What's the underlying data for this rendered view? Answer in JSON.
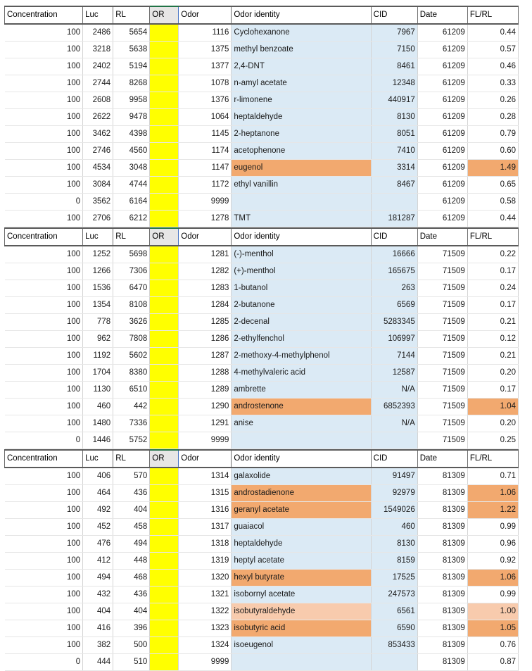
{
  "columns": [
    {
      "key": "concentration",
      "label": "Concentration"
    },
    {
      "key": "luc",
      "label": "Luc"
    },
    {
      "key": "rl",
      "label": "RL"
    },
    {
      "key": "or",
      "label": "OR"
    },
    {
      "key": "odor",
      "label": "Odor"
    },
    {
      "key": "identity",
      "label": "Odor identity"
    },
    {
      "key": "cid",
      "label": "CID"
    },
    {
      "key": "date",
      "label": "Date"
    },
    {
      "key": "flrl",
      "label": "FL/RL"
    }
  ],
  "colors": {
    "or_column_fill": "#ffff00",
    "identity_fill": "#dbeaf5",
    "cid_fill": "#dbeaf5",
    "highlight_light": "#f8cbad",
    "highlight_mid": "#f4b183",
    "highlight_strong": "#f2a96f",
    "header_selected_fill": "#e7e6e6",
    "header_border": "#5a5a5a",
    "selection_tab_green": "#217346"
  },
  "blocks": [
    {
      "id": "block-61209",
      "date": "61209",
      "rows": [
        {
          "concentration": "100",
          "luc": "2486",
          "rl": "5654",
          "or": "",
          "odor": "1116",
          "identity": "Cyclohexanone",
          "cid": "7967",
          "date": "61209",
          "flrl": "0.44",
          "highlight": 0
        },
        {
          "concentration": "100",
          "luc": "3218",
          "rl": "5638",
          "or": "",
          "odor": "1375",
          "identity": "methyl benzoate",
          "cid": "7150",
          "date": "61209",
          "flrl": "0.57",
          "highlight": 0
        },
        {
          "concentration": "100",
          "luc": "2402",
          "rl": "5194",
          "or": "",
          "odor": "1377",
          "identity": "2,4-DNT",
          "cid": "8461",
          "date": "61209",
          "flrl": "0.46",
          "highlight": 0
        },
        {
          "concentration": "100",
          "luc": "2744",
          "rl": "8268",
          "or": "",
          "odor": "1078",
          "identity": "n-amyl acetate",
          "cid": "12348",
          "date": "61209",
          "flrl": "0.33",
          "highlight": 0
        },
        {
          "concentration": "100",
          "luc": "2608",
          "rl": "9958",
          "or": "",
          "odor": "1376",
          "identity": "r-limonene",
          "cid": "440917",
          "date": "61209",
          "flrl": "0.26",
          "highlight": 0
        },
        {
          "concentration": "100",
          "luc": "2622",
          "rl": "9478",
          "or": "",
          "odor": "1064",
          "identity": "heptaldehyde",
          "cid": "8130",
          "date": "61209",
          "flrl": "0.28",
          "highlight": 0
        },
        {
          "concentration": "100",
          "luc": "3462",
          "rl": "4398",
          "or": "",
          "odor": "1145",
          "identity": "2-heptanone",
          "cid": "8051",
          "date": "61209",
          "flrl": "0.79",
          "highlight": 0
        },
        {
          "concentration": "100",
          "luc": "2746",
          "rl": "4560",
          "or": "",
          "odor": "1174",
          "identity": "acetophenone",
          "cid": "7410",
          "date": "61209",
          "flrl": "0.60",
          "highlight": 0
        },
        {
          "concentration": "100",
          "luc": "4534",
          "rl": "3048",
          "or": "",
          "odor": "1147",
          "identity": "eugenol",
          "cid": "3314",
          "date": "61209",
          "flrl": "1.49",
          "highlight": 3
        },
        {
          "concentration": "100",
          "luc": "3084",
          "rl": "4744",
          "or": "",
          "odor": "1172",
          "identity": "ethyl vanillin",
          "cid": "8467",
          "date": "61209",
          "flrl": "0.65",
          "highlight": 0
        },
        {
          "concentration": "0",
          "luc": "3562",
          "rl": "6164",
          "or": "",
          "odor": "9999",
          "identity": "",
          "cid": "",
          "date": "61209",
          "flrl": "0.58",
          "highlight": 0
        },
        {
          "concentration": "100",
          "luc": "2706",
          "rl": "6212",
          "or": "",
          "odor": "1278",
          "identity": "TMT",
          "cid": "181287",
          "date": "61209",
          "flrl": "0.44",
          "highlight": 0
        }
      ]
    },
    {
      "id": "block-71509",
      "date": "71509",
      "rows": [
        {
          "concentration": "100",
          "luc": "1252",
          "rl": "5698",
          "or": "",
          "odor": "1281",
          "identity": "(-)-menthol",
          "cid": "16666",
          "date": "71509",
          "flrl": "0.22",
          "highlight": 0
        },
        {
          "concentration": "100",
          "luc": "1266",
          "rl": "7306",
          "or": "",
          "odor": "1282",
          "identity": "(+)-menthol",
          "cid": "165675",
          "date": "71509",
          "flrl": "0.17",
          "highlight": 0
        },
        {
          "concentration": "100",
          "luc": "1536",
          "rl": "6470",
          "or": "",
          "odor": "1283",
          "identity": "1-butanol",
          "cid": "263",
          "date": "71509",
          "flrl": "0.24",
          "highlight": 0
        },
        {
          "concentration": "100",
          "luc": "1354",
          "rl": "8108",
          "or": "",
          "odor": "1284",
          "identity": "2-butanone",
          "cid": "6569",
          "date": "71509",
          "flrl": "0.17",
          "highlight": 0
        },
        {
          "concentration": "100",
          "luc": "778",
          "rl": "3626",
          "or": "",
          "odor": "1285",
          "identity": "2-decenal",
          "cid": "5283345",
          "date": "71509",
          "flrl": "0.21",
          "highlight": 0
        },
        {
          "concentration": "100",
          "luc": "962",
          "rl": "7808",
          "or": "",
          "odor": "1286",
          "identity": "2-ethylfenchol",
          "cid": "106997",
          "date": "71509",
          "flrl": "0.12",
          "highlight": 0
        },
        {
          "concentration": "100",
          "luc": "1192",
          "rl": "5602",
          "or": "",
          "odor": "1287",
          "identity": "2-methoxy-4-methylphenol",
          "cid": "7144",
          "date": "71509",
          "flrl": "0.21",
          "highlight": 0
        },
        {
          "concentration": "100",
          "luc": "1704",
          "rl": "8380",
          "or": "",
          "odor": "1288",
          "identity": "4-methylvaleric acid",
          "cid": "12587",
          "date": "71509",
          "flrl": "0.20",
          "highlight": 0
        },
        {
          "concentration": "100",
          "luc": "1130",
          "rl": "6510",
          "or": "",
          "odor": "1289",
          "identity": "ambrette",
          "cid": "N/A",
          "date": "71509",
          "flrl": "0.17",
          "highlight": 0
        },
        {
          "concentration": "100",
          "luc": "460",
          "rl": "442",
          "or": "",
          "odor": "1290",
          "identity": "androstenone",
          "cid": "6852393",
          "date": "71509",
          "flrl": "1.04",
          "highlight": 3
        },
        {
          "concentration": "100",
          "luc": "1480",
          "rl": "7336",
          "or": "",
          "odor": "1291",
          "identity": "anise",
          "cid": "N/A",
          "date": "71509",
          "flrl": "0.20",
          "highlight": 0
        },
        {
          "concentration": "0",
          "luc": "1446",
          "rl": "5752",
          "or": "",
          "odor": "9999",
          "identity": "",
          "cid": "",
          "date": "71509",
          "flrl": "0.25",
          "highlight": 0
        }
      ]
    },
    {
      "id": "block-81309",
      "date": "81309",
      "rows": [
        {
          "concentration": "100",
          "luc": "406",
          "rl": "570",
          "or": "",
          "odor": "1314",
          "identity": "galaxolide",
          "cid": "91497",
          "date": "81309",
          "flrl": "0.71",
          "highlight": 0
        },
        {
          "concentration": "100",
          "luc": "464",
          "rl": "436",
          "or": "",
          "odor": "1315",
          "identity": "androstadienone",
          "cid": "92979",
          "date": "81309",
          "flrl": "1.06",
          "highlight": 3
        },
        {
          "concentration": "100",
          "luc": "492",
          "rl": "404",
          "or": "",
          "odor": "1316",
          "identity": "geranyl acetate",
          "cid": "1549026",
          "date": "81309",
          "flrl": "1.22",
          "highlight": 3
        },
        {
          "concentration": "100",
          "luc": "452",
          "rl": "458",
          "or": "",
          "odor": "1317",
          "identity": "guaiacol",
          "cid": "460",
          "date": "81309",
          "flrl": "0.99",
          "highlight": 0
        },
        {
          "concentration": "100",
          "luc": "476",
          "rl": "494",
          "or": "",
          "odor": "1318",
          "identity": "heptaldehyde",
          "cid": "8130",
          "date": "81309",
          "flrl": "0.96",
          "highlight": 0
        },
        {
          "concentration": "100",
          "luc": "412",
          "rl": "448",
          "or": "",
          "odor": "1319",
          "identity": "heptyl acetate",
          "cid": "8159",
          "date": "81309",
          "flrl": "0.92",
          "highlight": 0
        },
        {
          "concentration": "100",
          "luc": "494",
          "rl": "468",
          "or": "",
          "odor": "1320",
          "identity": "hexyl butyrate",
          "cid": "17525",
          "date": "81309",
          "flrl": "1.06",
          "highlight": 3
        },
        {
          "concentration": "100",
          "luc": "432",
          "rl": "436",
          "or": "",
          "odor": "1321",
          "identity": "isobornyl acetate",
          "cid": "247573",
          "date": "81309",
          "flrl": "0.99",
          "highlight": 0
        },
        {
          "concentration": "100",
          "luc": "404",
          "rl": "404",
          "or": "",
          "odor": "1322",
          "identity": "isobutyraldehyde",
          "cid": "6561",
          "date": "81309",
          "flrl": "1.00",
          "highlight": 1
        },
        {
          "concentration": "100",
          "luc": "416",
          "rl": "396",
          "or": "",
          "odor": "1323",
          "identity": "isobutyric acid",
          "cid": "6590",
          "date": "81309",
          "flrl": "1.05",
          "highlight": 3
        },
        {
          "concentration": "100",
          "luc": "382",
          "rl": "500",
          "or": "",
          "odor": "1324",
          "identity": "isoeugenol",
          "cid": "853433",
          "date": "81309",
          "flrl": "0.76",
          "highlight": 0
        },
        {
          "concentration": "0",
          "luc": "444",
          "rl": "510",
          "or": "",
          "odor": "9999",
          "identity": "",
          "cid": "",
          "date": "81309",
          "flrl": "0.87",
          "highlight": 0
        }
      ]
    }
  ]
}
